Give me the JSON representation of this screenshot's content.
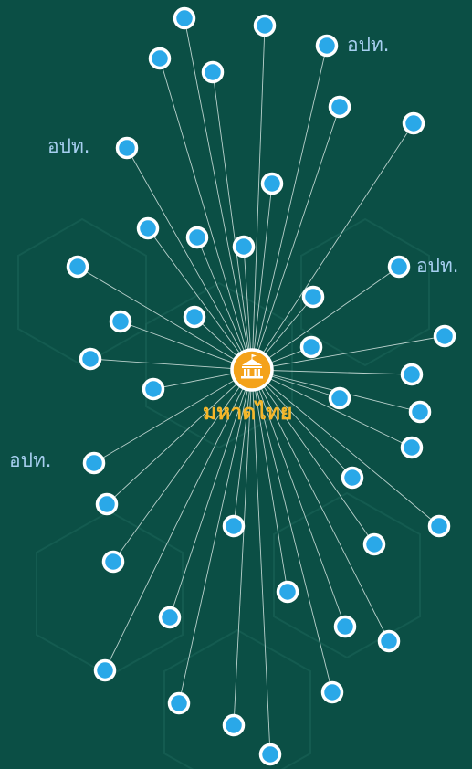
{
  "hub": {
    "label": "มหาดไทย",
    "icon": "government-building-icon"
  },
  "outer_node_count": 48,
  "node_labels": [
    "อปท.",
    "อปท.",
    "อปท.",
    "อปท."
  ],
  "colors": {
    "background": "#0b4f45",
    "node_fill": "#2aa8e8",
    "node_stroke": "#ffffff",
    "hub_fill": "#f4a21a",
    "hub_label": "#f4b62a",
    "node_label": "#a7cff0",
    "link": "#d8e8e4"
  }
}
